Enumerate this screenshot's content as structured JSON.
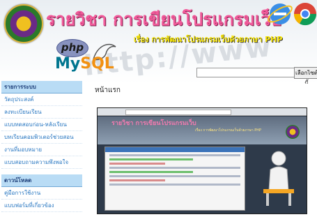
{
  "banner": {
    "title": "รายวิชา การเขียนโปรแกรมเว็บ",
    "subtitle": "เรื่อง การพัฒนาโปรแกรมเว็บด้วยภาษา PHP",
    "php_logo_text": "php",
    "mysql_logo_my": "My",
    "mysql_logo_sql": "SQL",
    "background_text": "http://www"
  },
  "search": {
    "value": "",
    "button_label": "เลือกไซต์นี้"
  },
  "sidebar": {
    "sections": [
      {
        "heading": "รายการระบบ",
        "items": [
          "วัตถุประสงค์",
          "ลงทะเบียนเรียน",
          "แบบทดสอบก่อน-หลังเรียน",
          "บทเรียนคอมพิวเตอร์ช่วยสอน",
          "งานที่มอบหมาย",
          "แบบสอบถามความพึงพอใจ"
        ]
      },
      {
        "heading": "ดาวน์โหลด",
        "items": [
          "คู่มือการใช้งาน",
          "แบบฟอร์มที่เกี่ยวข้อง"
        ]
      }
    ]
  },
  "main": {
    "page_title": "หน้าแรก",
    "screenshot": {
      "title": "รายวิชา การเขียนโปรแกรมเว็บ",
      "subtitle": "เรื่อง การพัฒนาโปรแกรมเว็บด้วยภาษา PHP"
    }
  },
  "colors": {
    "title": "#f15a9a",
    "subtitle": "#f7e400",
    "sidebar_head_bg": "#b9dcf5",
    "sidebar_link": "#2a78c2"
  }
}
